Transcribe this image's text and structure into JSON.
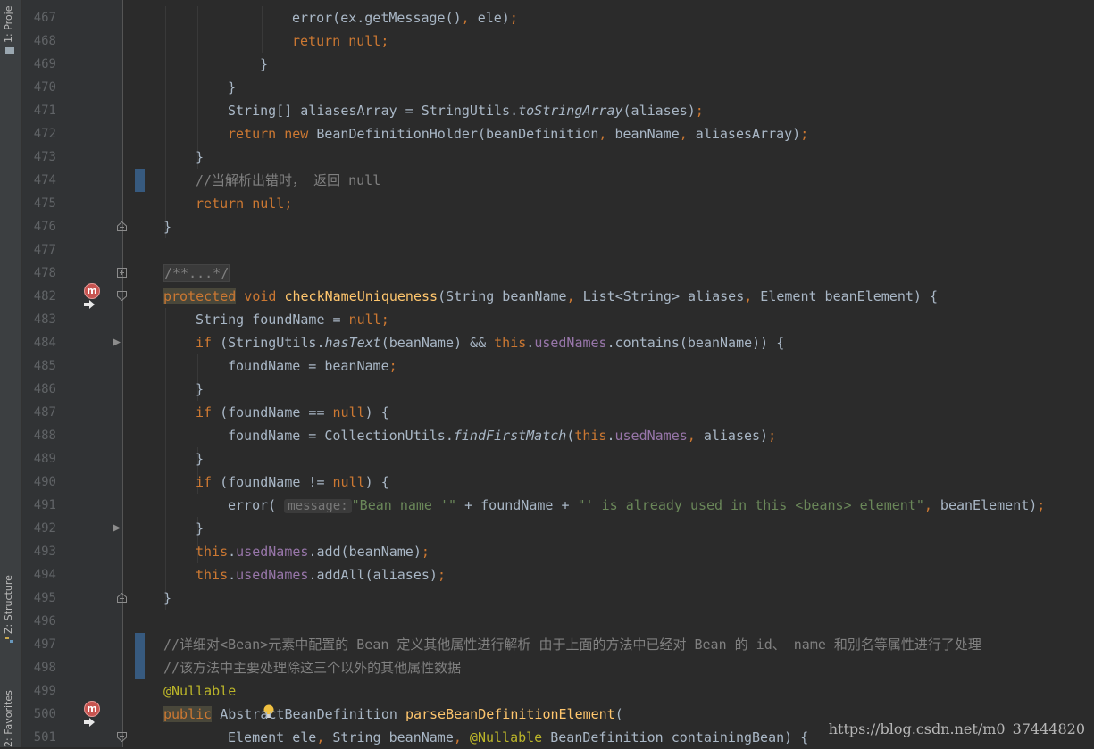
{
  "sidebar": {
    "tabs": [
      {
        "id": "project",
        "label": "1: Proje"
      },
      {
        "id": "structure",
        "label": "Z: Structure"
      },
      {
        "id": "favorites",
        "label": "2: Favorites"
      }
    ]
  },
  "lines": [
    {
      "n": "467",
      "ind": 4,
      "s": [
        [
          "",
          "error("
        ],
        [
          "",
          "ex.getMessage()"
        ],
        [
          "kw",
          ","
        ],
        [
          "",
          " ele)"
        ],
        [
          "kw",
          ";"
        ]
      ]
    },
    {
      "n": "468",
      "ind": 4,
      "s": [
        [
          "kw",
          "return null;"
        ]
      ]
    },
    {
      "n": "469",
      "ind": 3,
      "s": [
        [
          "",
          "}"
        ]
      ]
    },
    {
      "n": "470",
      "ind": 2,
      "s": [
        [
          "",
          "}"
        ]
      ]
    },
    {
      "n": "471",
      "ind": 2,
      "s": [
        [
          "",
          "String[] aliasesArray = StringUtils."
        ],
        [
          "it",
          "toStringArray"
        ],
        [
          "",
          "(aliases)"
        ],
        [
          "kw",
          ";"
        ]
      ]
    },
    {
      "n": "472",
      "ind": 2,
      "s": [
        [
          "kw",
          "return new "
        ],
        [
          "",
          "BeanDefinitionHolder(beanDefinition"
        ],
        [
          "kw",
          ","
        ],
        [
          "",
          " beanName"
        ],
        [
          "kw",
          ","
        ],
        [
          "",
          " aliasesArray)"
        ],
        [
          "kw",
          ";"
        ]
      ]
    },
    {
      "n": "473",
      "ind": 1,
      "s": [
        [
          "",
          "}"
        ]
      ]
    },
    {
      "n": "474",
      "ind": 1,
      "s": [
        [
          "cm",
          "//当解析出错时， 返回 null"
        ]
      ]
    },
    {
      "n": "475",
      "ind": 1,
      "s": [
        [
          "kw",
          "return null;"
        ]
      ]
    },
    {
      "n": "476",
      "ind": 0,
      "s": [
        [
          "",
          "}"
        ]
      ]
    },
    {
      "n": "477",
      "ind": 0,
      "s": []
    },
    {
      "n": "478",
      "ind": 0,
      "s": [
        [
          "cm fold-box",
          "/**...*/"
        ]
      ]
    },
    {
      "n": "482",
      "ind": 0,
      "s": [
        [
          "kw hl-word",
          "protected"
        ],
        [
          "kw",
          " void "
        ],
        [
          "fn",
          "checkNameUniqueness"
        ],
        [
          "",
          "(String beanName"
        ],
        [
          "kw",
          ","
        ],
        [
          "",
          " List<String> aliases"
        ],
        [
          "kw",
          ","
        ],
        [
          "",
          " Element beanElement) {"
        ]
      ]
    },
    {
      "n": "483",
      "ind": 1,
      "s": [
        [
          "",
          "String foundName = "
        ],
        [
          "kw",
          "null;"
        ]
      ]
    },
    {
      "n": "484",
      "ind": 1,
      "s": [
        [
          "kw",
          "if "
        ],
        [
          "",
          "(StringUtils."
        ],
        [
          "it",
          "hasText"
        ],
        [
          "",
          "(beanName) && "
        ],
        [
          "kw",
          "this"
        ],
        [
          "",
          "."
        ],
        [
          "fld",
          "usedNames"
        ],
        [
          "",
          ".contains(beanName)) {"
        ]
      ]
    },
    {
      "n": "485",
      "ind": 2,
      "s": [
        [
          "",
          "foundName = beanName"
        ],
        [
          "kw",
          ";"
        ]
      ]
    },
    {
      "n": "486",
      "ind": 1,
      "s": [
        [
          "",
          "}"
        ]
      ]
    },
    {
      "n": "487",
      "ind": 1,
      "s": [
        [
          "kw",
          "if "
        ],
        [
          "",
          "(foundName == "
        ],
        [
          "kw",
          "null"
        ],
        [
          "",
          ") {"
        ]
      ]
    },
    {
      "n": "488",
      "ind": 2,
      "s": [
        [
          "",
          "foundName = CollectionUtils."
        ],
        [
          "it",
          "findFirstMatch"
        ],
        [
          "",
          "("
        ],
        [
          "kw",
          "this"
        ],
        [
          "",
          "."
        ],
        [
          "fld",
          "usedNames"
        ],
        [
          "kw",
          ","
        ],
        [
          "",
          " aliases)"
        ],
        [
          "kw",
          ";"
        ]
      ]
    },
    {
      "n": "489",
      "ind": 1,
      "s": [
        [
          "",
          "}"
        ]
      ]
    },
    {
      "n": "490",
      "ind": 1,
      "s": [
        [
          "kw",
          "if "
        ],
        [
          "",
          "(foundName != "
        ],
        [
          "kw",
          "null"
        ],
        [
          "",
          ") {"
        ]
      ]
    },
    {
      "n": "491",
      "ind": 2,
      "s": [
        [
          "",
          "error( "
        ],
        [
          "hint",
          "message:"
        ],
        [
          "str",
          "\"Bean name '\""
        ],
        [
          "",
          " + foundName + "
        ],
        [
          "str",
          "\"' is already used in this <beans> element\""
        ],
        [
          "kw",
          ","
        ],
        [
          "",
          " beanElement)"
        ],
        [
          "kw",
          ";"
        ]
      ]
    },
    {
      "n": "492",
      "ind": 1,
      "s": [
        [
          "",
          "}"
        ]
      ]
    },
    {
      "n": "493",
      "ind": 1,
      "s": [
        [
          "kw",
          "this"
        ],
        [
          "",
          "."
        ],
        [
          "fld",
          "usedNames"
        ],
        [
          "",
          ".add(beanName)"
        ],
        [
          "kw",
          ";"
        ]
      ]
    },
    {
      "n": "494",
      "ind": 1,
      "s": [
        [
          "kw",
          "this"
        ],
        [
          "",
          "."
        ],
        [
          "fld",
          "usedNames"
        ],
        [
          "",
          ".addAll(aliases)"
        ],
        [
          "kw",
          ";"
        ]
      ]
    },
    {
      "n": "495",
      "ind": 0,
      "s": [
        [
          "",
          "}"
        ]
      ]
    },
    {
      "n": "496",
      "ind": 0,
      "s": []
    },
    {
      "n": "497",
      "ind": 0,
      "s": [
        [
          "cm",
          "//详细对<Bean>元素中配置的 Bean 定义其他属性进行解析 由于上面的方法中已经对 Bean 的 id、 name 和别名等属性进行了处理"
        ]
      ]
    },
    {
      "n": "498",
      "ind": 0,
      "s": [
        [
          "cm",
          "//该方法中主要处理除这三个以外的其他属性数据"
        ]
      ]
    },
    {
      "n": "499",
      "ind": 0,
      "s": [
        [
          "ann",
          "@Nullable"
        ]
      ]
    },
    {
      "n": "500",
      "ind": 0,
      "s": [
        [
          "kw hl-word",
          "public"
        ],
        [
          "",
          " AbstractBeanDefinition "
        ],
        [
          "fn",
          "parseBeanDefinitionElement"
        ],
        [
          "",
          "("
        ]
      ]
    },
    {
      "n": "501",
      "ind": 2,
      "s": [
        [
          "",
          "Element ele"
        ],
        [
          "kw",
          ","
        ],
        [
          "",
          " String beanName"
        ],
        [
          "kw",
          ","
        ],
        [
          "ann",
          " @Nullable"
        ],
        [
          "",
          " BeanDefinition containingBean) {"
        ]
      ]
    }
  ],
  "markers": {
    "method_icon_glyph": "m",
    "method_lines": [
      "482",
      "500"
    ],
    "bulb_line": "500"
  },
  "watermark": "https://blog.csdn.net/m0_37444820"
}
